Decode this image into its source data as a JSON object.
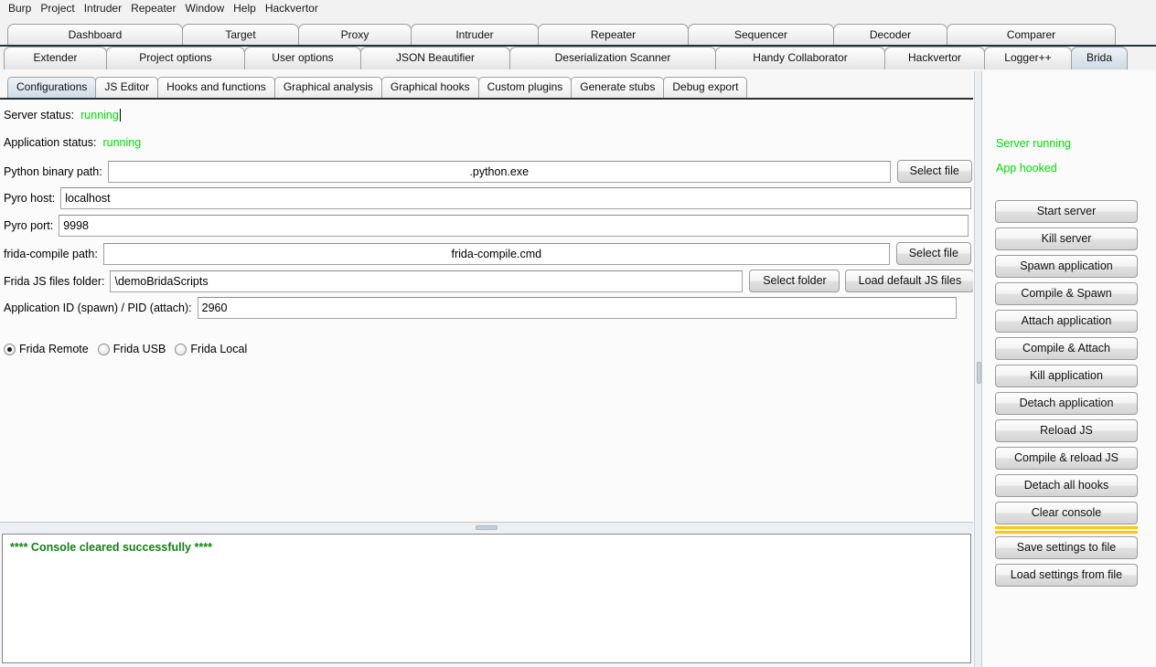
{
  "menubar": {
    "items": [
      {
        "label": "Burp"
      },
      {
        "label": "Project"
      },
      {
        "label": "Intruder"
      },
      {
        "label": "Repeater"
      },
      {
        "label": "Window"
      },
      {
        "label": "Help"
      },
      {
        "label": "Hackvertor"
      }
    ]
  },
  "main_tabs": {
    "row1": [
      {
        "label": "Dashboard",
        "selected": false
      },
      {
        "label": "Target",
        "selected": false
      },
      {
        "label": "Proxy",
        "selected": false
      },
      {
        "label": "Intruder",
        "selected": false
      },
      {
        "label": "Repeater",
        "selected": false
      },
      {
        "label": "Sequencer",
        "selected": false
      },
      {
        "label": "Decoder",
        "selected": false
      },
      {
        "label": "Comparer",
        "selected": false
      }
    ],
    "row2": [
      {
        "label": "Extender",
        "selected": false
      },
      {
        "label": "Project options",
        "selected": false
      },
      {
        "label": "User options",
        "selected": false
      },
      {
        "label": "JSON Beautifier",
        "selected": false
      },
      {
        "label": "Deserialization Scanner",
        "selected": false
      },
      {
        "label": "Handy Collaborator",
        "selected": false
      },
      {
        "label": "Hackvertor",
        "selected": false
      },
      {
        "label": "Logger++",
        "selected": false
      },
      {
        "label": "Brida",
        "selected": true
      }
    ]
  },
  "inner_tabs": [
    {
      "label": "Configurations",
      "selected": true
    },
    {
      "label": "JS Editor",
      "selected": false
    },
    {
      "label": "Hooks and functions",
      "selected": false
    },
    {
      "label": "Graphical analysis",
      "selected": false
    },
    {
      "label": "Graphical hooks",
      "selected": false
    },
    {
      "label": "Custom plugins",
      "selected": false
    },
    {
      "label": "Generate stubs",
      "selected": false
    },
    {
      "label": "Debug export",
      "selected": false
    }
  ],
  "config": {
    "server_status_label": "Server status:",
    "server_status_value": "running",
    "application_status_label": "Application status:",
    "application_status_value": "running",
    "python_path_label": "Python binary path:",
    "python_path_value": ".python.exe",
    "python_path_button": "Select file",
    "pyro_host_label": "Pyro host:",
    "pyro_host_value": "localhost",
    "pyro_port_label": "Pyro port:",
    "pyro_port_value": "9998",
    "frida_compile_label": "frida-compile path:",
    "frida_compile_value": "frida-compile.cmd",
    "frida_compile_button": "Select file",
    "js_folder_label": "Frida JS files folder:",
    "js_folder_value": "    \\demoBridaScripts",
    "js_folder_button": "Select folder",
    "js_default_button": "Load default JS files",
    "app_id_label": "Application ID (spawn) / PID (attach):",
    "app_id_value": "2960",
    "modes": [
      {
        "label": "Frida Remote",
        "selected": true
      },
      {
        "label": "Frida USB",
        "selected": false
      },
      {
        "label": "Frida Local",
        "selected": false
      }
    ]
  },
  "console": {
    "lines": [
      "**** Console cleared successfully ****"
    ]
  },
  "actions": {
    "status": [
      {
        "label": "Server running"
      },
      {
        "label": "App hooked"
      }
    ],
    "buttons_top": [
      {
        "label": "Start server"
      },
      {
        "label": "Kill server"
      },
      {
        "label": "Spawn application"
      },
      {
        "label": "Compile & Spawn"
      },
      {
        "label": "Attach application"
      },
      {
        "label": "Compile & Attach"
      },
      {
        "label": "Kill application"
      },
      {
        "label": "Detach application"
      },
      {
        "label": "Reload JS"
      },
      {
        "label": "Compile & reload JS"
      },
      {
        "label": "Detach all hooks"
      },
      {
        "label": "Clear console"
      }
    ],
    "buttons_bottom": [
      {
        "label": "Save settings to file"
      },
      {
        "label": "Load settings from file"
      }
    ]
  },
  "colors": {
    "status_green": "#00dd00",
    "console_green": "#128012",
    "separator_yellow": "#ffc60b",
    "tab_selected": "#dde6ee",
    "tab_underline": "#24323f"
  }
}
